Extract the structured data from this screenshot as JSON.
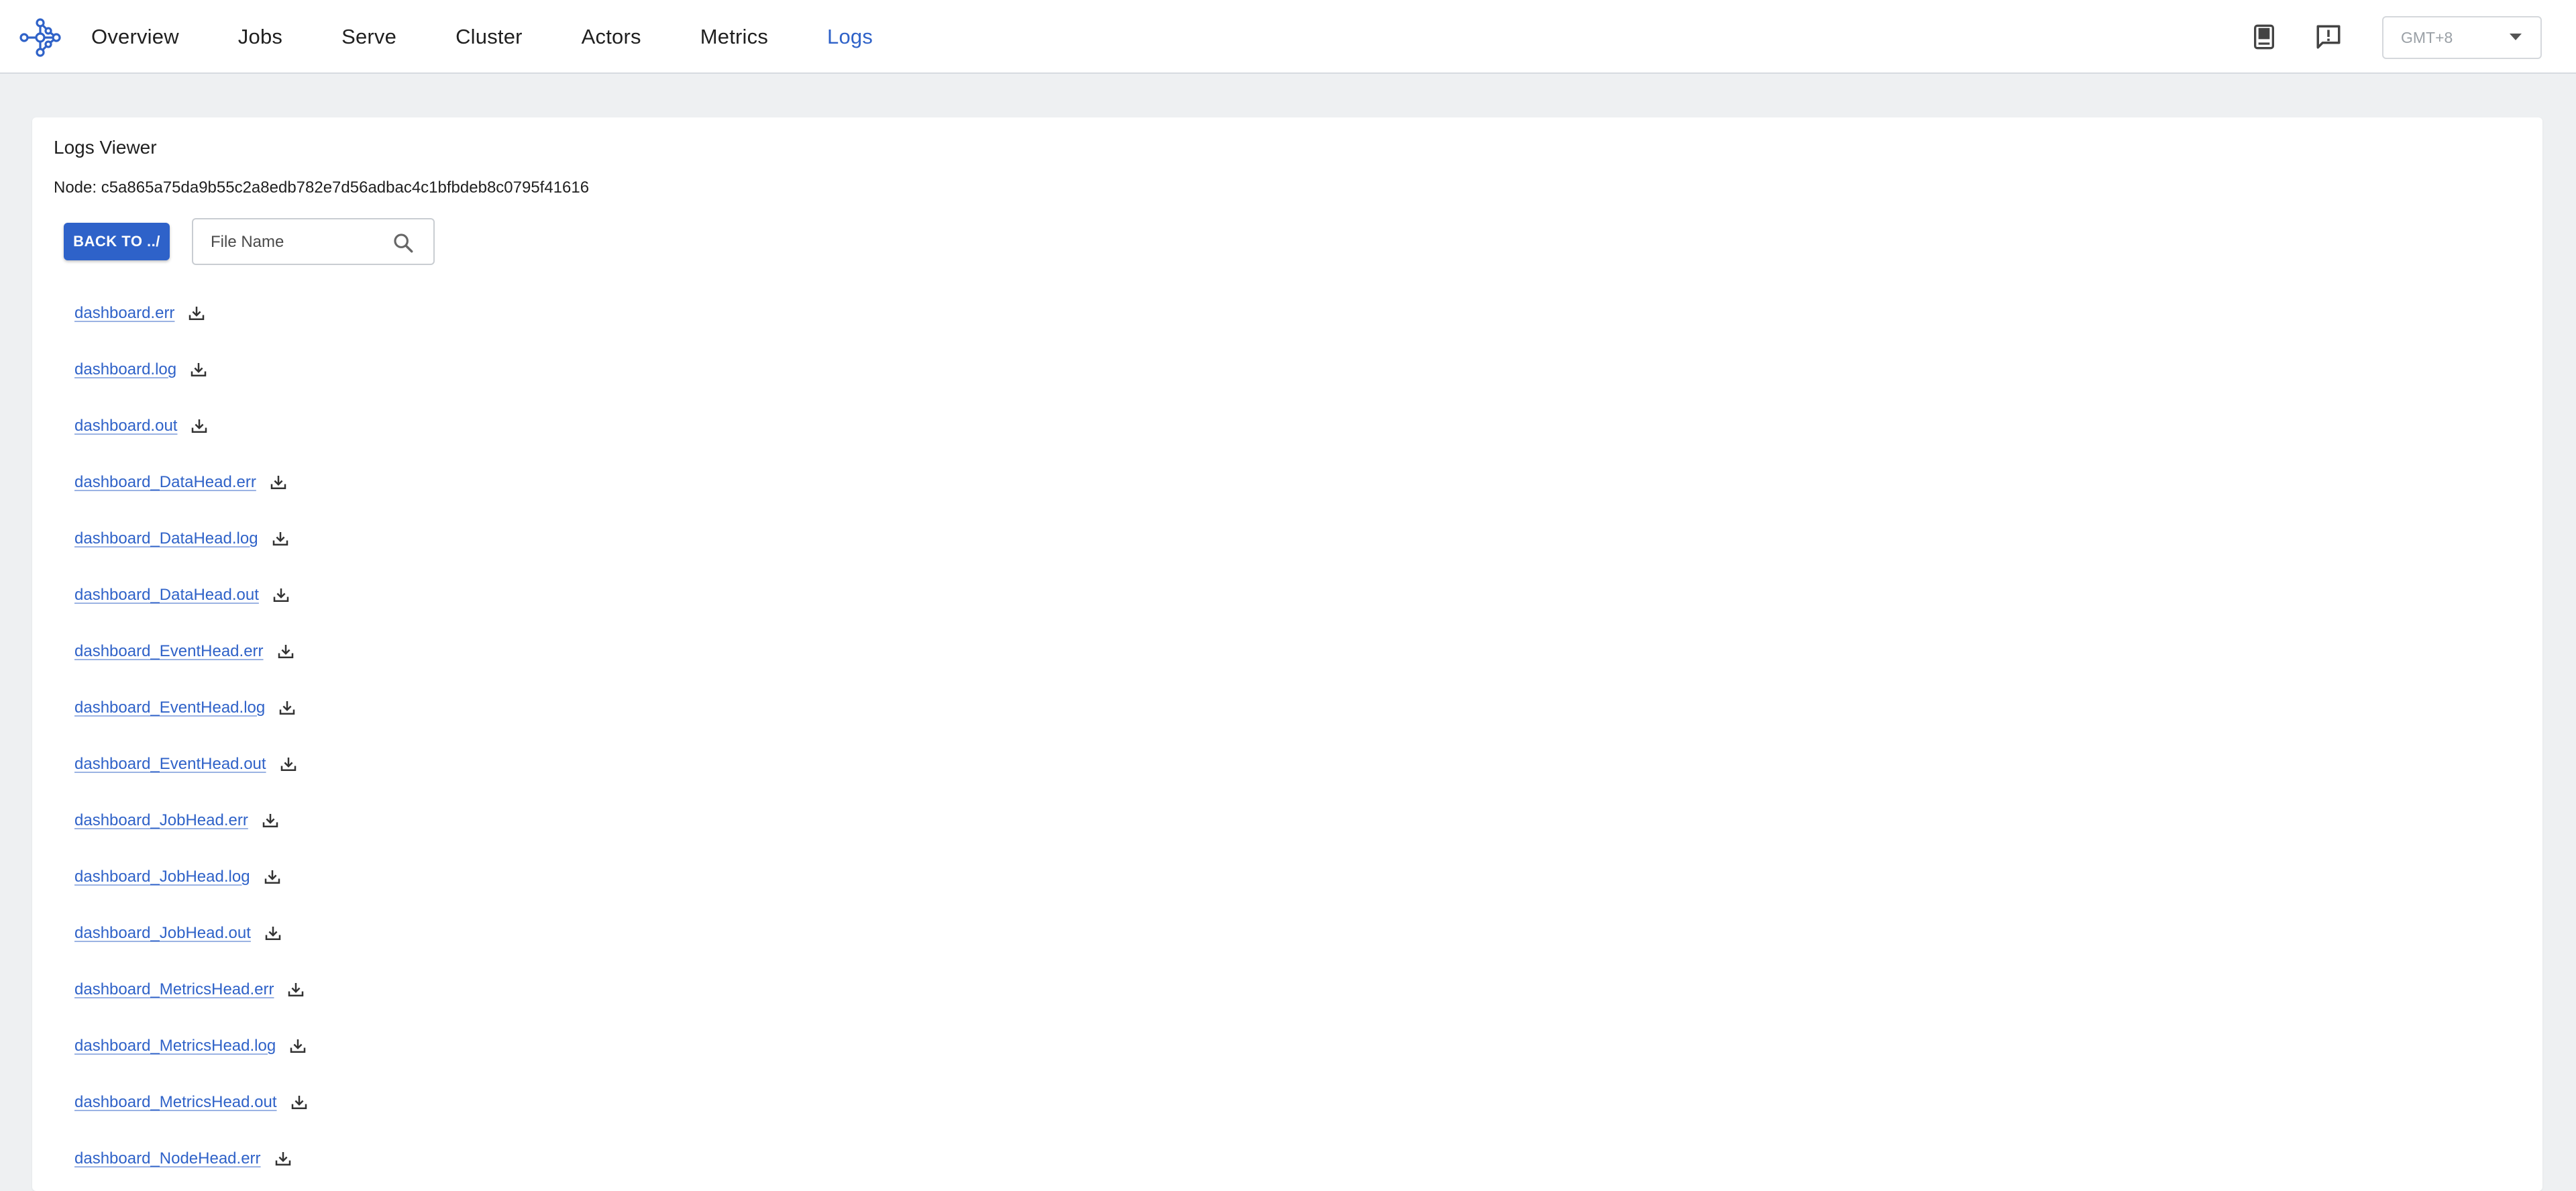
{
  "nav": {
    "items": [
      {
        "label": "Overview",
        "active": false
      },
      {
        "label": "Jobs",
        "active": false
      },
      {
        "label": "Serve",
        "active": false
      },
      {
        "label": "Cluster",
        "active": false
      },
      {
        "label": "Actors",
        "active": false
      },
      {
        "label": "Metrics",
        "active": false
      },
      {
        "label": "Logs",
        "active": true
      }
    ],
    "icons": [
      "docs-book-icon",
      "feedback-icon"
    ],
    "timezone": "GMT+8"
  },
  "logs": {
    "title": "Logs Viewer",
    "node": "Node: c5a865a75da9b55c2a8edb782e7d56adbac4c1bfbdeb8c0795f41616",
    "back_label": "BACK TO ../",
    "search_placeholder": "File Name",
    "files": [
      "dashboard.err",
      "dashboard.log",
      "dashboard.out",
      "dashboard_DataHead.err",
      "dashboard_DataHead.log",
      "dashboard_DataHead.out",
      "dashboard_EventHead.err",
      "dashboard_EventHead.log",
      "dashboard_EventHead.out",
      "dashboard_JobHead.err",
      "dashboard_JobHead.log",
      "dashboard_JobHead.out",
      "dashboard_MetricsHead.err",
      "dashboard_MetricsHead.log",
      "dashboard_MetricsHead.out",
      "dashboard_NodeHead.err"
    ]
  },
  "colors": {
    "accent": "#2f62c8",
    "button": "#2e62c9",
    "background": "#eef0f2"
  }
}
